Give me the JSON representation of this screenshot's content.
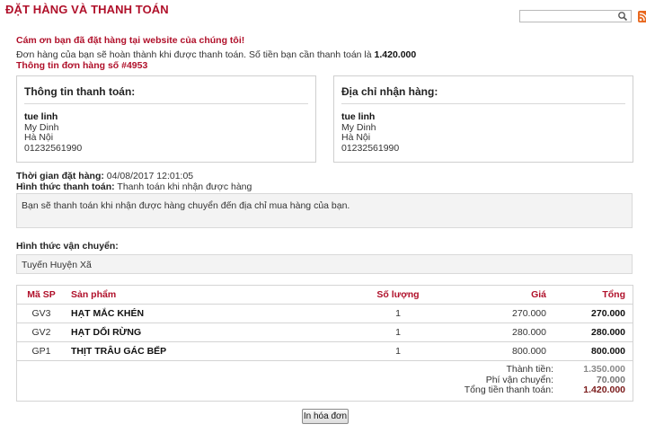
{
  "page": {
    "title": "ĐẶT HÀNG VÀ THANH TOÁN"
  },
  "header": {
    "search_placeholder": "",
    "rss_icon": "rss-icon",
    "search_icon": "search-icon"
  },
  "messages": {
    "thanks": "Cám ơn bạn đã đặt hàng tại website của chúng tôi!",
    "intro": "Đơn hàng của bạn sẽ hoàn thành khi được thanh toán. Số tiền bạn cần thanh toán là ",
    "amount_due": "1.420.000",
    "order_number": "Thông tin đơn hàng số #4953"
  },
  "billing": {
    "heading": "Thông tin thanh toán:",
    "name": "tue linh",
    "address": "My Dinh",
    "city": "Hà Nội",
    "phone": "01232561990"
  },
  "shipping_address": {
    "heading": "Địa chỉ nhận hàng:",
    "name": "tue linh",
    "address": "My Dinh",
    "city": "Hà Nội",
    "phone": "01232561990"
  },
  "order_meta": {
    "time_label": "Thời gian đặt hàng:",
    "time_value": "04/08/2017 12:01:05",
    "payment_label": "Hình thức thanh toán:",
    "payment_value": "Thanh toán khi nhận được hàng",
    "payment_note": "Bạn sẽ thanh toán khi nhận được hàng chuyển đến địa chỉ mua hàng của bạn.",
    "shipping_label": "Hình thức vận chuyển:",
    "shipping_value": "Tuyến Huyện Xã"
  },
  "table": {
    "headers": {
      "code": "Mã SP",
      "product": "Sản phẩm",
      "quantity": "Số lượng",
      "price": "Giá",
      "total": "Tổng"
    },
    "rows": [
      {
        "code": "GV3",
        "product": "HẠT MẮC KHÉN",
        "quantity": "1",
        "price": "270.000",
        "total": "270.000"
      },
      {
        "code": "GV2",
        "product": "HẠT DỔI RỪNG",
        "quantity": "1",
        "price": "280.000",
        "total": "280.000"
      },
      {
        "code": "GP1",
        "product": "THỊT TRÂU GÁC BẾP",
        "quantity": "1",
        "price": "800.000",
        "total": "800.000"
      }
    ],
    "summary": {
      "subtotal_label": "Thành tiền:",
      "subtotal_value": "1.350.000",
      "shipping_label": "Phí vận chuyển:",
      "shipping_value": "70.000",
      "grand_label": "Tổng tiền thanh toán:",
      "grand_value": "1.420.000"
    }
  },
  "actions": {
    "print_label": "In hóa đơn"
  },
  "colors": {
    "accent": "#b0102a",
    "subtotal": "#888888",
    "shipping_fee": "#777777",
    "grand_total": "#7a1a1a"
  }
}
